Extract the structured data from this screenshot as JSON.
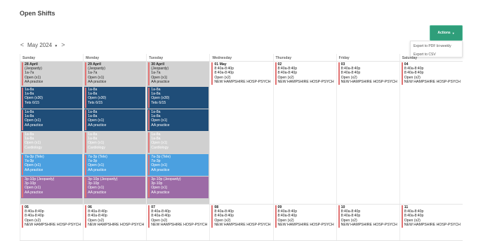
{
  "page_title": "Open Shifts",
  "actions": {
    "label": "Actions",
    "menu": [
      "Export to PDF bi-weekly",
      "Export to CSV"
    ]
  },
  "nav": {
    "prev": "<",
    "month": "May 2024",
    "next": ">"
  },
  "days_header": [
    "Sunday",
    "Monday",
    "Tuesday",
    "Wednesday",
    "Thursday",
    "Friday",
    "Saturday"
  ],
  "week1": {
    "past": [
      {
        "date": "28 April",
        "blocks": [
          {
            "type": "plain",
            "lines": [
              "(Jeopardy)",
              "1a-7a",
              "Open (x1)",
              "AA practice"
            ]
          },
          {
            "type": "navy",
            "lines": [
              "1a-8a",
              "1a-8a",
              "Open (x30)",
              "Tets 6/15"
            ]
          },
          {
            "type": "navy",
            "lines": [
              "1a-8a",
              "1a-8a",
              "Open (x1)",
              "AA practice"
            ]
          },
          {
            "type": "gray",
            "lines": [
              "1a-8a",
              "1a-8a",
              "Open (x1)",
              "Cardiology"
            ]
          },
          {
            "type": "blue",
            "lines": [
              "7a-3p (Tele)",
              "7a-3p",
              "Open (x1)",
              "AA practice"
            ]
          },
          {
            "type": "purple",
            "lines": [
              "3p-10p (Jeopardy)",
              "3p-10p",
              "Open (x1)",
              "AA practice"
            ]
          }
        ]
      },
      {
        "date": "29 April",
        "blocks": [
          {
            "type": "plain",
            "lines": [
              "(Jeopardy)",
              "1a-7a",
              "Open (x1)",
              "AA practice"
            ]
          },
          {
            "type": "navy",
            "lines": [
              "1a-8a",
              "1a-8a",
              "Open (x30)",
              "Tets 6/15"
            ]
          },
          {
            "type": "navy",
            "lines": [
              "1a-8a",
              "1a-8a",
              "Open (x1)",
              "AA practice"
            ]
          },
          {
            "type": "gray",
            "lines": [
              "1a-8a",
              "1a-8a",
              "Open (x1)",
              "Cardiology"
            ]
          },
          {
            "type": "blue",
            "lines": [
              "7a-3p (Tele)",
              "7a-3p",
              "Open (x1)",
              "AA practice"
            ]
          },
          {
            "type": "purple",
            "lines": [
              "3p-10p (Jeopardy)",
              "3p-10p",
              "Open (x1)",
              "AA practice"
            ]
          }
        ]
      },
      {
        "date": "30 April",
        "blocks": [
          {
            "type": "plain",
            "lines": [
              "(Jeopardy)",
              "1a-7a",
              "Open (x1)",
              "AA practice"
            ]
          },
          {
            "type": "navy",
            "lines": [
              "1a-8a",
              "1a-8a",
              "Open (x30)",
              "Tets 6/15"
            ]
          },
          {
            "type": "navy",
            "lines": [
              "1a-8a",
              "1a-8a",
              "Open (x1)",
              "AA practice"
            ]
          },
          {
            "type": "gray",
            "lines": [
              "1a-8a",
              "1a-8a",
              "Open (x1)",
              "Cardiology"
            ]
          },
          {
            "type": "blue",
            "lines": [
              "7a-3p (Tele)",
              "7a-3p",
              "Open (x1)",
              "AA practice"
            ]
          },
          {
            "type": "purple",
            "lines": [
              "3p-10p (Jeopardy)",
              "3p-10p",
              "Open (x1)",
              "AA practice"
            ]
          }
        ]
      }
    ],
    "future": [
      {
        "date": "01 May",
        "lines": [
          "8:40a-8:40p",
          "8:40a-8:40p",
          "Open (x2)",
          "NEW HAMPSHIRE HOSP-PSYCH"
        ]
      },
      {
        "date": "02",
        "lines": [
          "8:40a-8:40p",
          "8:40a-8:40p",
          "Open (x2)",
          "NEW HAMPSHIRE HOSP-PSYCH"
        ]
      },
      {
        "date": "03",
        "lines": [
          "8:40a-8:40p",
          "8:40a-8:40p",
          "Open (x2)",
          "NEW HAMPSHIRE HOSP-PSYCH"
        ]
      },
      {
        "date": "04",
        "lines": [
          "8:40a-8:40p",
          "8:40a-8:40p",
          "Open (x2)",
          "NEW HAMPSHIRE HOSP-PSYCH"
        ]
      }
    ]
  },
  "week2": [
    {
      "date": "05",
      "lines": [
        "8:40a-8:40p",
        "8:40a-8:40p",
        "Open (x2)",
        "NEW HAMPSHIRE HOSP-PSYCH"
      ]
    },
    {
      "date": "06",
      "lines": [
        "8:40a-8:40p",
        "8:40a-8:40p",
        "Open (x2)",
        "NEW HAMPSHIRE HOSP-PSYCH"
      ]
    },
    {
      "date": "07",
      "lines": [
        "8:40a-8:40p",
        "8:40a-8:40p",
        "Open (x2)",
        "NEW HAMPSHIRE HOSP-PSYCH"
      ]
    },
    {
      "date": "08",
      "lines": [
        "8:40a-8:40p",
        "8:40a-8:40p",
        "Open (x2)",
        "NEW HAMPSHIRE HOSP-PSYCH"
      ]
    },
    {
      "date": "09",
      "lines": [
        "8:40a-8:40p",
        "8:40a-8:40p",
        "Open (x2)",
        "NEW HAMPSHIRE HOSP-PSYCH"
      ]
    },
    {
      "date": "10",
      "lines": [
        "8:40a-8:40p",
        "8:40a-8:40p",
        "Open (x2)",
        "NEW HAMPSHIRE HOSP-PSYCH"
      ]
    },
    {
      "date": "11",
      "lines": [
        "8:40a-8:40p",
        "8:40a-8:40p",
        "Open (x2)",
        "NEW HAMPSHIRE HOSP-PSYCH"
      ]
    }
  ],
  "colors": {
    "accent": "#2f9e7a",
    "navy": "#1f4d78",
    "blue": "#4ba0e0",
    "purple": "#9c6ba6",
    "marker": "#e27373",
    "past_bg": "#d2d2d2"
  }
}
